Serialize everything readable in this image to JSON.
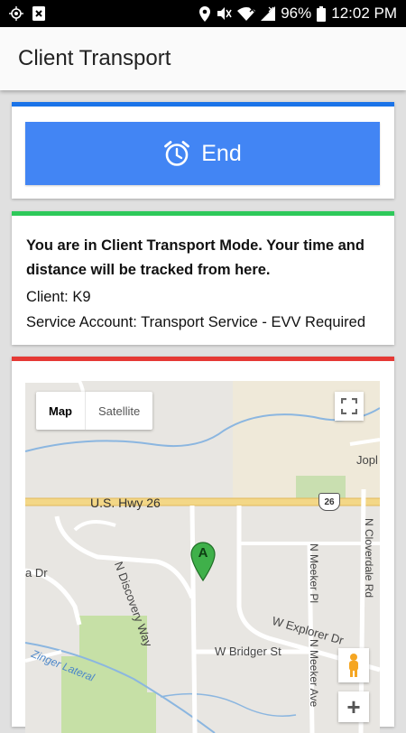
{
  "status_bar": {
    "battery": "96%",
    "time": "12:02 PM"
  },
  "app_bar": {
    "title": "Client Transport"
  },
  "actions": {
    "end_label": "End"
  },
  "info": {
    "mode_message": "You are in Client Transport Mode. Your time and distance will be tracked from here.",
    "client_line": "Client: K9",
    "service_account_line": "Service Account: Transport Service - EVV Required"
  },
  "map": {
    "type_options": [
      "Map",
      "Satellite"
    ],
    "marker_label": "A",
    "highway_shield": "26",
    "labels": {
      "highway": "U.S. Hwy 26",
      "discovery_way": "N Discovery Way",
      "meeker_pl": "N Meeker Pl",
      "meeker_ave": "N Meeker Ave",
      "explorer_dr": "W Explorer Dr",
      "bridger_st": "W Bridger St",
      "cloverdale_rd": "N Cloverdale Rd",
      "zinger_lateral": "Zinger Lateral",
      "jopl": "Jopl",
      "dr": "a Dr"
    }
  },
  "colors": {
    "accent_blue": "#1a73e8",
    "button_blue": "#4285f4",
    "status_green": "#2ec95a",
    "status_red": "#e53935"
  }
}
